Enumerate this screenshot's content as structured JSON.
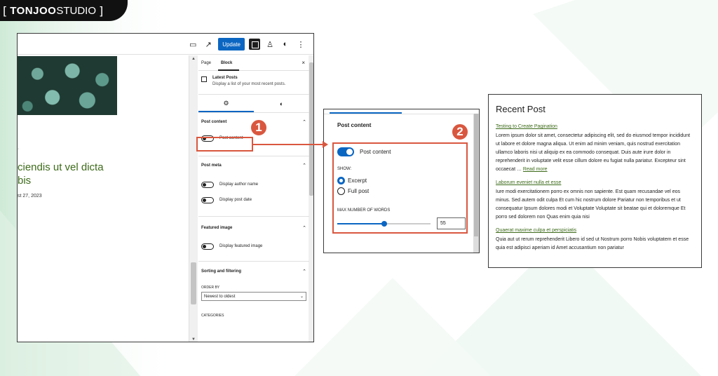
{
  "logo": {
    "open_bracket": "[",
    "brand_bold": "TONJOO",
    "brand_light": "STUDIO",
    "close_bracket": "]"
  },
  "toolbar": {
    "update_label": "Update",
    "icons": [
      "desktop-icon",
      "external-link-icon",
      "settings-toggle-icon",
      "jetpack-icon",
      "styles-icon",
      "more-vertical-icon"
    ],
    "more_label": "⋮"
  },
  "canvas": {
    "post_title_line1": "ciendis ut vel dicta",
    "post_title_line2": "bis",
    "post_date": "st 27, 2023"
  },
  "sidebar": {
    "tabs": [
      "Page",
      "Block"
    ],
    "active_tab": "Block",
    "close_label": "×",
    "block_name": "Latest Posts",
    "block_description": "Display a list of your most recent posts.",
    "settings_tabs": [
      "gear-icon",
      "styles-icon"
    ],
    "panels": {
      "post_content": {
        "title": "Post content",
        "toggle_label": "Post content"
      },
      "post_meta": {
        "title": "Post meta",
        "author_label": "Display author name",
        "date_label": "Display post date"
      },
      "featured_image": {
        "title": "Featured image",
        "toggle_label": "Display featured image"
      },
      "sorting": {
        "title": "Sorting and filtering",
        "order_by_label": "ORDER BY",
        "order_by_value": "Newest to oldest",
        "categories_label": "CATEGORIES"
      }
    }
  },
  "callouts": {
    "badge1": "1",
    "badge2": "2"
  },
  "zoom_panel": {
    "title": "Post content",
    "toggle_label": "Post content",
    "toggle_on": true,
    "show_label": "SHOW:",
    "options": [
      "Excerpt",
      "Full post"
    ],
    "selected_option": "Excerpt",
    "max_words_label": "MAX NUMBER OF WORDS",
    "max_words_value": "55",
    "slider_fraction": 0.5
  },
  "recent_posts": {
    "heading": "Recent Post",
    "posts": [
      {
        "title": "Testing to Create Pagination",
        "excerpt": "Lorem ipsum dolor sit amet, consectetur adipiscing elit, sed do eiusmod tempor incididunt ut labore et dolore magna aliqua. Ut enim ad minim veniam, quis nostrud exercitation ullamco laboris nisi ut aliquip ex ea commodo consequat. Duis aute irure dolor in reprehenderit in voluptate velit esse cillum dolore eu fugiat nulla pariatur. Excepteur sint occaecat …",
        "read_more": "Read more"
      },
      {
        "title": "Laborum eveniet nulla et esse",
        "excerpt": "Iure modi exercitationem porro ex omnis non sapiente. Est quam recusandae vel eos minus. Sed autem odit culpa Et cum hic nostrum dolore Pariatur non temporibus et ut consequatur Ipsum dolores modi et Voluptate Voluptate sit beatae qui et doloremque Et porro sed dolorem non Quas enim quia nisi",
        "read_more": ""
      },
      {
        "title": "Quaerat maxime culpa et perspiciatis",
        "excerpt": "Quia aut ut rerum reprehenderit Libero id sed ut Nostrum porro Nobis voluptatem et esse quia est adipisci aperiam id Amet accusantium non pariatur",
        "read_more": ""
      }
    ]
  },
  "colors": {
    "accent": "#0b66c2",
    "callout": "#d9573f",
    "link": "#3d6b1a",
    "background_green": "#e6f3ea"
  }
}
